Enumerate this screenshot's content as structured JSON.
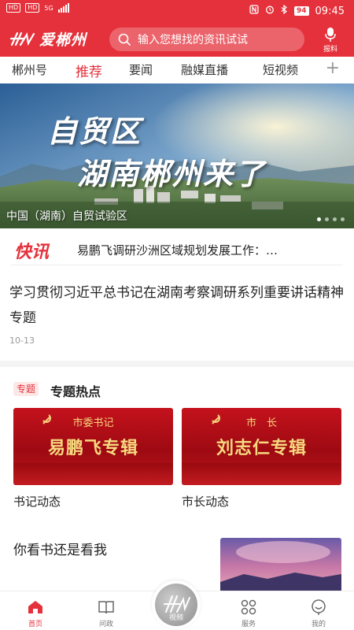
{
  "status_bar": {
    "left_chips": [
      "HD",
      "HD"
    ],
    "network": "5G",
    "battery": "94",
    "time": "09:45"
  },
  "header": {
    "app_name": "爱郴州",
    "search_placeholder": "输入您想找的资讯试试",
    "report_label": "报料",
    "colors": {
      "brand_red": "#e5313b"
    }
  },
  "tabs": {
    "items": [
      "郴州号",
      "推荐",
      "要闻",
      "融媒直播",
      "短视频"
    ],
    "active": "推荐",
    "add_icon": "plus-icon"
  },
  "banner": {
    "headline_line1": "自贸区",
    "headline_line2": "湖南郴州来了",
    "caption": "中国（湖南）自贸试验区",
    "page_count": 4,
    "active_page": 1
  },
  "flash_news": {
    "tag": "快讯",
    "text": "易鹏飞调研沙洲区域规划发展工作：…"
  },
  "article": {
    "title": "学习贯彻习近平总书记在湖南考察调研系列重要讲话精神专题",
    "date": "10-13"
  },
  "topics": {
    "tag": "专题",
    "title": "专题热点",
    "cards": [
      {
        "sub": "市委书记",
        "main": "易鹏飞专辑",
        "label": "书记动态"
      },
      {
        "sub": "市　长",
        "main": "刘志仁专辑",
        "label": "市长动态"
      }
    ]
  },
  "feed": {
    "title": "你看书还是看我"
  },
  "bottom_nav": {
    "items": [
      {
        "label": "首页",
        "icon": "home-icon",
        "active": true
      },
      {
        "label": "问政",
        "icon": "book-icon",
        "active": false
      },
      {
        "label": "视频",
        "icon": "video-icon",
        "active": false
      },
      {
        "label": "服务",
        "icon": "services-grid-icon",
        "active": false
      },
      {
        "label": "我的",
        "icon": "profile-icon",
        "active": false
      }
    ]
  }
}
